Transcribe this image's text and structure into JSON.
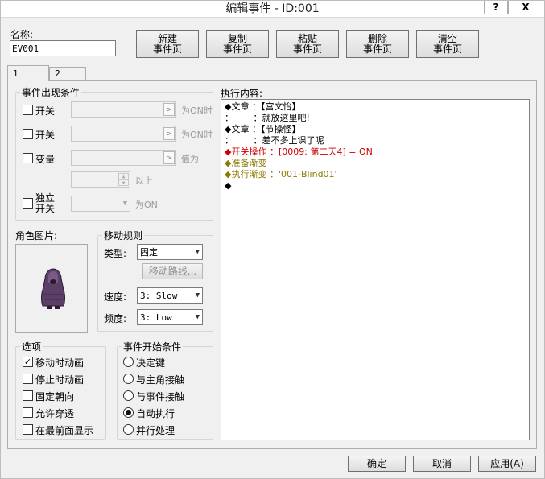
{
  "window": {
    "title": "编辑事件 - ID:001",
    "help_button": "?",
    "close_button": "X"
  },
  "name": {
    "label": "名称:",
    "value": "EV001"
  },
  "toolbar": {
    "new_page": [
      "新建",
      "事件页"
    ],
    "copy_page": [
      "复制",
      "事件页"
    ],
    "paste_page": [
      "粘贴",
      "事件页"
    ],
    "delete_page": [
      "删除",
      "事件页"
    ],
    "clear_page": [
      "清空",
      "事件页"
    ]
  },
  "tabs": [
    {
      "label": "1",
      "active": true
    },
    {
      "label": "2",
      "active": false
    }
  ],
  "conditions": {
    "title": "事件出现条件",
    "switch1_label": "开关",
    "switch1_suffix": "为ON时",
    "switch2_label": "开关",
    "switch2_suffix": "为ON时",
    "variable_label": "变量",
    "variable_suffix": "值为",
    "variable_above": "以上",
    "self_switch_label_1": "独立",
    "self_switch_label_2": "开关",
    "self_switch_suffix": "为ON"
  },
  "graphic": {
    "label": "角色图片:"
  },
  "movement": {
    "title": "移动规则",
    "type_label": "类型:",
    "type_value": "固定",
    "route_button": "移动路线...",
    "speed_label": "速度:",
    "speed_value": "3: Slow",
    "freq_label": "频度:",
    "freq_value": "3: Low"
  },
  "options": {
    "title": "选项",
    "items": [
      {
        "label": "移动时动画",
        "checked": true
      },
      {
        "label": "停止时动画",
        "checked": false
      },
      {
        "label": "固定朝向",
        "checked": false
      },
      {
        "label": "允许穿透",
        "checked": false
      },
      {
        "label": "在最前面显示",
        "checked": false
      }
    ]
  },
  "trigger": {
    "title": "事件开始条件",
    "items": [
      {
        "label": "决定键",
        "selected": false
      },
      {
        "label": "与主角接触",
        "selected": false
      },
      {
        "label": "与事件接触",
        "selected": false
      },
      {
        "label": "自动执行",
        "selected": true
      },
      {
        "label": "并行处理",
        "selected": false
      }
    ]
  },
  "contents": {
    "label": "执行内容:",
    "lines": [
      {
        "text": "◆文章 ：【宫文怡】",
        "color": "#000000"
      },
      {
        "text": "：       ：就放这里吧!",
        "color": "#000000"
      },
      {
        "text": "◆文章 ：【节操怪】",
        "color": "#000000"
      },
      {
        "text": "：       ：差不多上课了呢",
        "color": "#000000"
      },
      {
        "text": "◆开关操作 ：[0009: 第二天4] = ON",
        "color": "#cc0000"
      },
      {
        "text": "◆准备渐变",
        "color": "#8a7a00"
      },
      {
        "text": "◆执行渐变 ：'001-Blind01'",
        "color": "#8a7a00"
      },
      {
        "text": "◆",
        "color": "#000000"
      }
    ]
  },
  "footer": {
    "ok": "确定",
    "cancel": "取消",
    "apply": "应用(A)"
  }
}
